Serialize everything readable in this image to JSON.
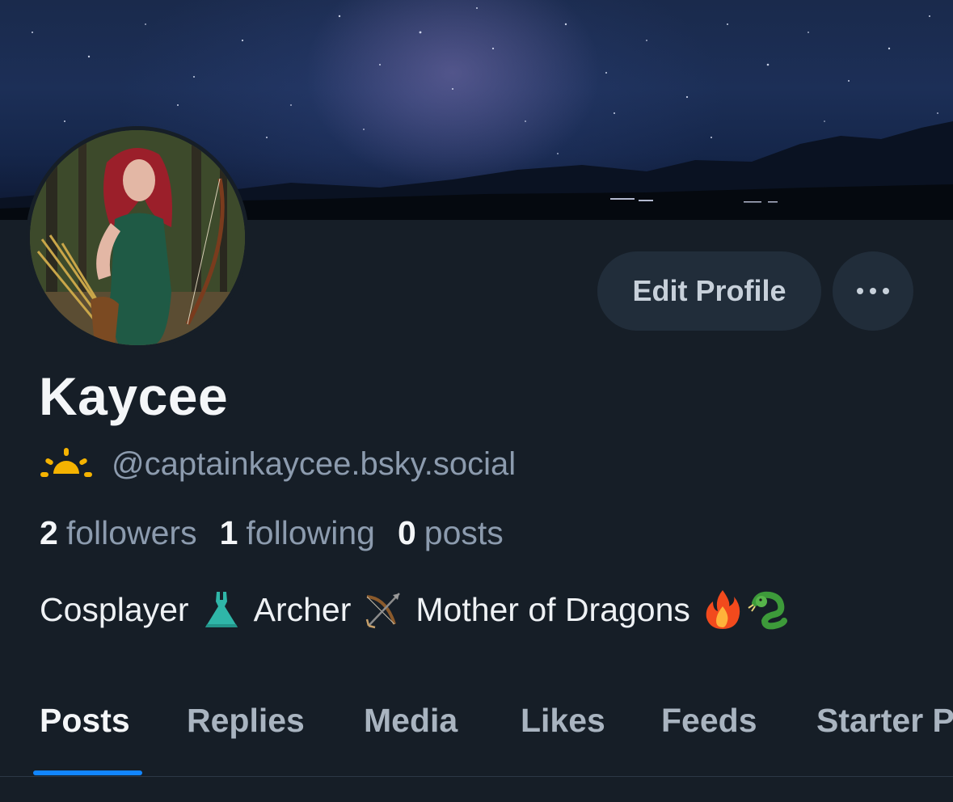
{
  "profile": {
    "display_name": "Kaycee",
    "handle": "@captainkaycee.bsky.social",
    "handle_icon": "sunrise-icon",
    "bio": {
      "part1": "Cosplayer",
      "part2": "Archer",
      "part3": "Mother of Dragons"
    },
    "bio_icons": [
      "dress-icon",
      "bow-and-arrow-icon",
      "fire-icon",
      "dragon-icon"
    ]
  },
  "stats": {
    "followers_count": "2",
    "followers_label": "followers",
    "following_count": "1",
    "following_label": "following",
    "posts_count": "0",
    "posts_label": "posts"
  },
  "actions": {
    "edit_profile_label": "Edit Profile",
    "more_icon": "more-horizontal-icon"
  },
  "tabs": [
    {
      "label": "Posts",
      "active": true
    },
    {
      "label": "Replies",
      "active": false
    },
    {
      "label": "Media",
      "active": false
    },
    {
      "label": "Likes",
      "active": false
    },
    {
      "label": "Feeds",
      "active": false
    },
    {
      "label": "Starter Packs",
      "active": false
    }
  ],
  "colors": {
    "background": "#161e27",
    "accent": "#1185fe",
    "muted_text": "#8c9bae",
    "button_bg": "#212d3a"
  }
}
